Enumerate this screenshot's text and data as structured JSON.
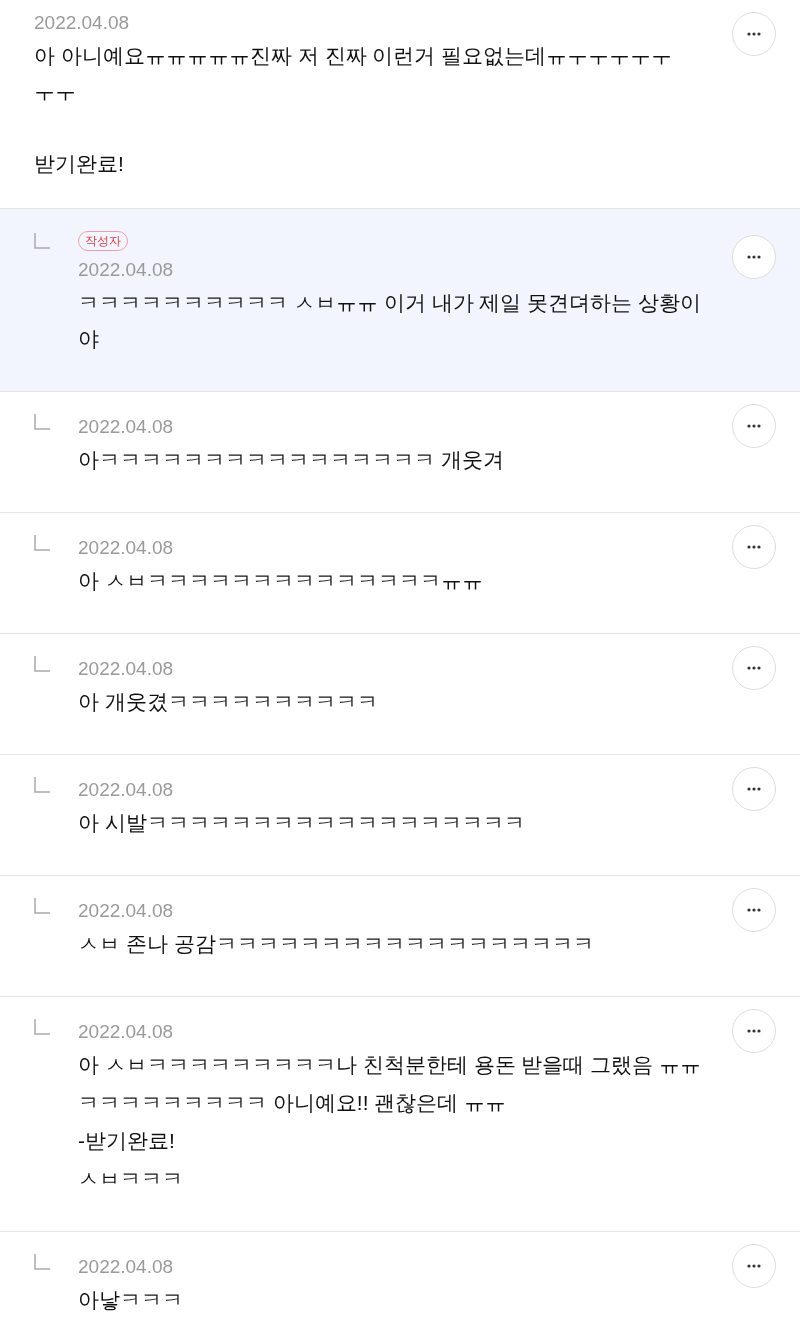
{
  "comments": [
    {
      "kind": "comment",
      "date": "2022.04.08",
      "paragraphs": [
        [
          "아 아니예요ㅠㅠㅠㅠㅠ진짜 저 진짜 이런거 필요없는데ㅠㅜㅜㅜㅜㅜㅜㅜ"
        ],
        [
          "받기완료!"
        ]
      ],
      "highlighted": false
    },
    {
      "kind": "reply",
      "author_badge": "작성자",
      "date": "2022.04.08",
      "paragraphs": [
        [
          "ㅋㅋㅋㅋㅋㅋㅋㅋㅋㅋ ㅅㅂㅠㅠ 이거 내가 제일 못견뎌하는 상황이야"
        ]
      ],
      "highlighted": true
    },
    {
      "kind": "reply",
      "date": "2022.04.08",
      "paragraphs": [
        [
          "아ㅋㅋㅋㅋㅋㅋㅋㅋㅋㅋㅋㅋㅋㅋㅋㅋ 개웃겨"
        ]
      ],
      "highlighted": false
    },
    {
      "kind": "reply",
      "date": "2022.04.08",
      "paragraphs": [
        [
          "아 ㅅㅂㅋㅋㅋㅋㅋㅋㅋㅋㅋㅋㅋㅋㅋㅋㅠㅠ"
        ]
      ],
      "highlighted": false
    },
    {
      "kind": "reply",
      "date": "2022.04.08",
      "paragraphs": [
        [
          "아 개웃겼ㅋㅋㅋㅋㅋㅋㅋㅋㅋㅋ"
        ]
      ],
      "highlighted": false
    },
    {
      "kind": "reply",
      "date": "2022.04.08",
      "paragraphs": [
        [
          "아 시발ㅋㅋㅋㅋㅋㅋㅋㅋㅋㅋㅋㅋㅋㅋㅋㅋㅋㅋ"
        ]
      ],
      "highlighted": false
    },
    {
      "kind": "reply",
      "date": "2022.04.08",
      "paragraphs": [
        [
          "ㅅㅂ 존나 공감ㅋㅋㅋㅋㅋㅋㅋㅋㅋㅋㅋㅋㅋㅋㅋㅋㅋㅋ"
        ]
      ],
      "highlighted": false
    },
    {
      "kind": "reply",
      "date": "2022.04.08",
      "paragraphs": [
        [
          "아 ㅅㅂㅋㅋㅋㅋㅋㅋㅋㅋㅋ나 친척분한테 용돈 받을때 그랬음 ㅠㅠ",
          "ㅋㅋㅋㅋㅋㅋㅋㅋㅋ 아니예요!! 괜찮은데 ㅠㅠ",
          "-받기완료!",
          "ㅅㅂㅋㅋㅋ"
        ]
      ],
      "highlighted": false
    },
    {
      "kind": "reply",
      "date": "2022.04.08",
      "paragraphs": [
        [
          "아낳ㅋㅋㅋ"
        ]
      ],
      "highlighted": false
    }
  ]
}
